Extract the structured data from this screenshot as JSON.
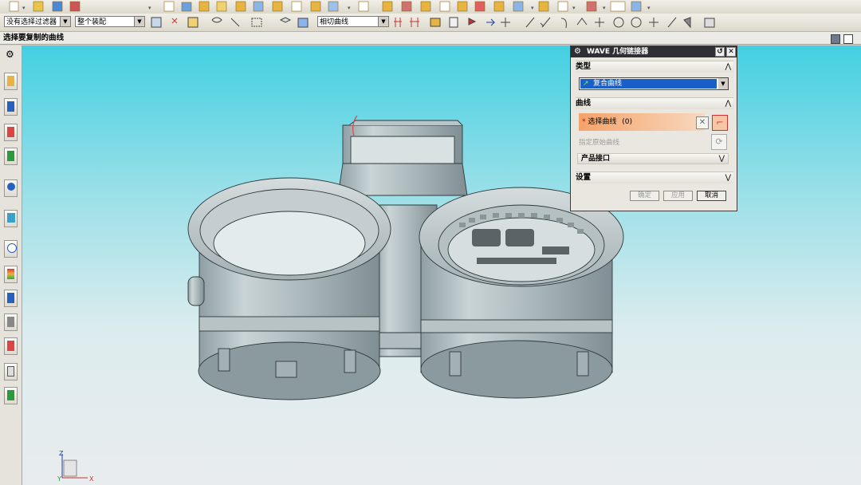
{
  "toolbar": {
    "filter_select": {
      "value": "没有选择过滤器"
    },
    "scope_select": {
      "value": "整个装配"
    },
    "curve_rule_select": {
      "value": "相切曲线"
    }
  },
  "cue_line": "选择要复制的曲线",
  "dialog": {
    "title": "WAVE 几何链接器",
    "type_section": "类型",
    "type_value": "复合曲线",
    "curve_section": "曲线",
    "select_curve": "选择曲线",
    "select_curve_count": "(0)",
    "specify_origin_curve": "指定原始曲线",
    "product_interface": "产品接口",
    "settings_section": "设置",
    "ok": "确定",
    "apply": "应用",
    "cancel": "取消"
  },
  "triad": {
    "x_label": "X",
    "z_label": "Z",
    "y_label": "Y"
  },
  "colors": {
    "viewport_top": "#43d0e2",
    "viewport_bottom": "#e9ecee",
    "dialog_title": "#2e3036",
    "highlight": "#f0a060"
  }
}
